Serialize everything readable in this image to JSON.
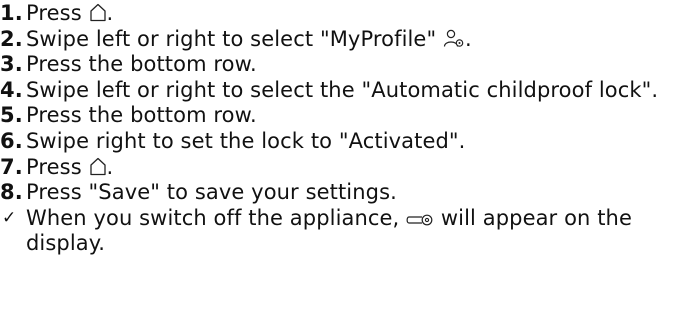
{
  "steps": [
    {
      "number": "1.",
      "before": "Press ",
      "icon": "home-icon",
      "after": "."
    },
    {
      "number": "2.",
      "before": "Swipe left or right to select \"MyProfile\" ",
      "icon": "profile-settings-icon",
      "after": "."
    },
    {
      "number": "3.",
      "text": "Press the bottom row."
    },
    {
      "number": "4.",
      "text": "Swipe left or right to select the \"Automatic childproof lock\"."
    },
    {
      "number": "5.",
      "text": "Press the bottom row."
    },
    {
      "number": "6.",
      "text": "Swipe right to set the lock to \"Activated\"."
    },
    {
      "number": "7.",
      "before": "Press ",
      "icon": "home-icon",
      "after": "."
    },
    {
      "number": "8.",
      "text": "Press \"Save\" to save your settings."
    }
  ],
  "result": {
    "marker": "✓",
    "before": "When you switch off the appliance, ",
    "icon": "childproof-lock-key-icon",
    "after": " will appear on the display."
  }
}
